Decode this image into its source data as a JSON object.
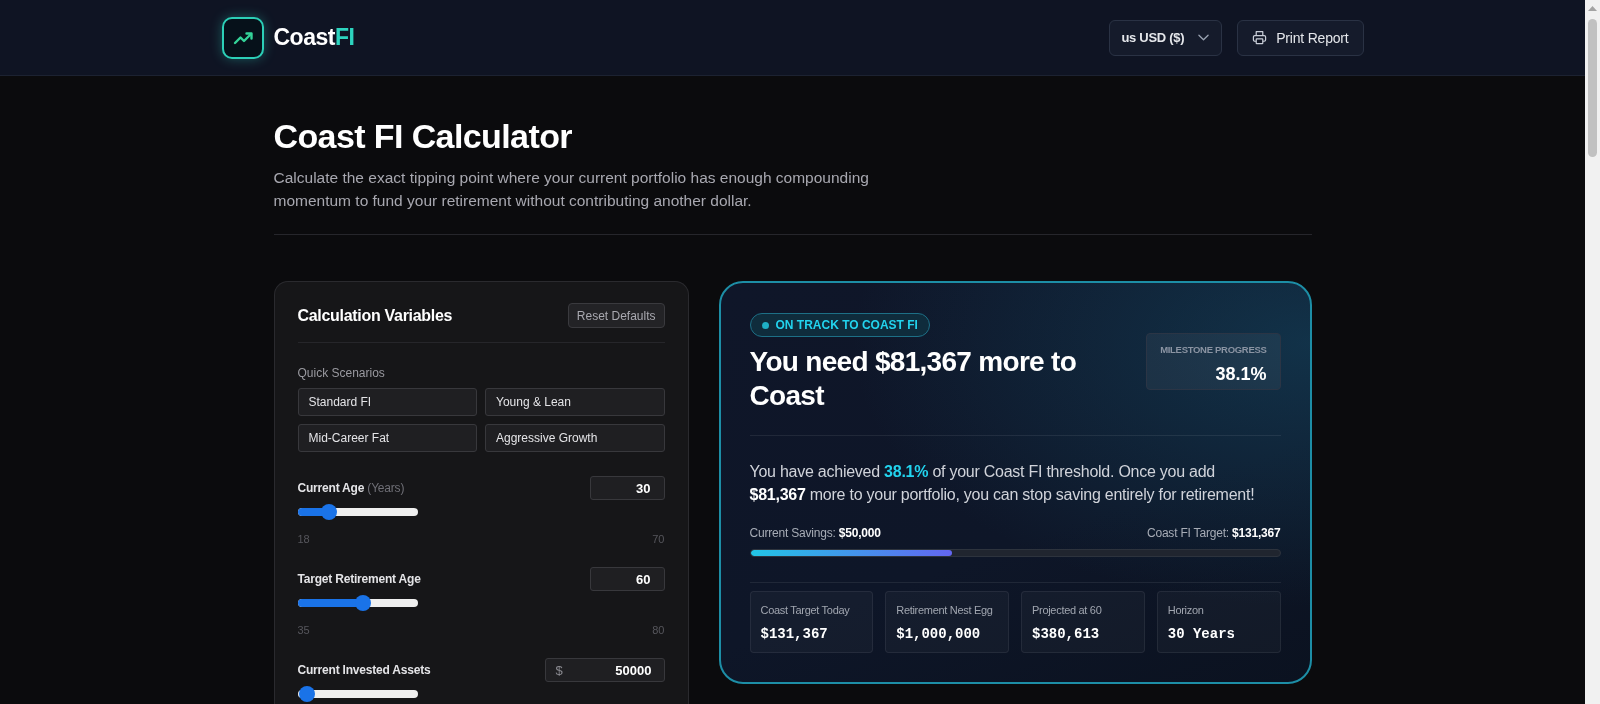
{
  "header": {
    "logo_text": "Coast",
    "logo_accent": "FI",
    "currency_select": {
      "value": "us USD ($)"
    },
    "print_button": "Print Report"
  },
  "intro": {
    "title": "Coast FI Calculator",
    "subtitle": "Calculate the exact tipping point where your current portfolio has enough compounding momentum to fund your retirement without contributing another dollar."
  },
  "variables_panel": {
    "title": "Calculation Variables",
    "reset_button": "Reset Defaults",
    "scenarios_label": "Quick Scenarios",
    "scenarios": [
      "Standard FI",
      "Young & Lean",
      "Mid-Career Fat",
      "Aggressive Growth"
    ],
    "fields": [
      {
        "label": "Current Age",
        "hint": "(Years)",
        "value": "30",
        "level": 0.23,
        "min": "18",
        "max": "70"
      },
      {
        "label": "Target Retirement Age",
        "value": "60",
        "level": 0.556,
        "min": "35",
        "max": "80"
      },
      {
        "label": "Current Invested Assets",
        "prefix": "$",
        "value": "50000",
        "level": 0.01
      }
    ]
  },
  "result_card": {
    "badge": "ON TRACK TO COAST FI",
    "headline": "You need $81,367 more to Coast",
    "milestone": {
      "label": "MILESTONE PROGRESS",
      "value": "38.1%"
    },
    "summary": "You have achieved **38.1%** of your Coast FI threshold. Once you add **$81,367** more to your portfolio, you can stop saving entirely for retirement!",
    "progress": {
      "start_label": "Current Savings: **$50,000**",
      "end_label": "Coast FI Target: **$131,367**",
      "level": 0.381
    },
    "stats": [
      {
        "label": "Coast Target Today",
        "value": "$131,367"
      },
      {
        "label": "Retirement Nest Egg",
        "value": "$1,000,000"
      },
      {
        "label": "Projected at 60",
        "value": "$380,613"
      },
      {
        "label": "Horizon",
        "value": "30 Years"
      }
    ]
  }
}
